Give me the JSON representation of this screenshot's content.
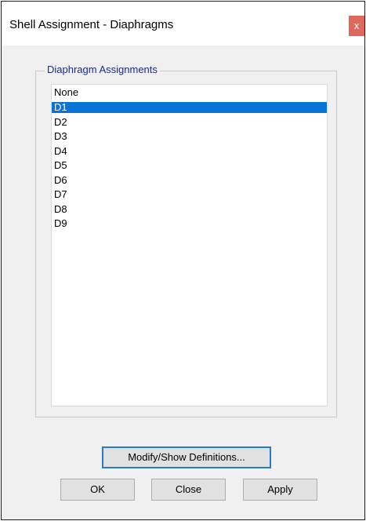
{
  "window": {
    "title": "Shell Assignment - Diaphragms",
    "close_glyph": "x"
  },
  "group": {
    "label": "Diaphragm Assignments"
  },
  "list": {
    "items": [
      "None",
      "D1",
      "D2",
      "D3",
      "D4",
      "D5",
      "D6",
      "D7",
      "D8",
      "D9"
    ],
    "selected": "D1"
  },
  "buttons": {
    "modify_label": "Modify/Show Definitions...",
    "ok_label": "OK",
    "close_label": "Close",
    "apply_label": "Apply"
  },
  "colors": {
    "selection": "#0a74d6",
    "close_button": "#e0675b",
    "group_label": "#1c2a8c"
  }
}
